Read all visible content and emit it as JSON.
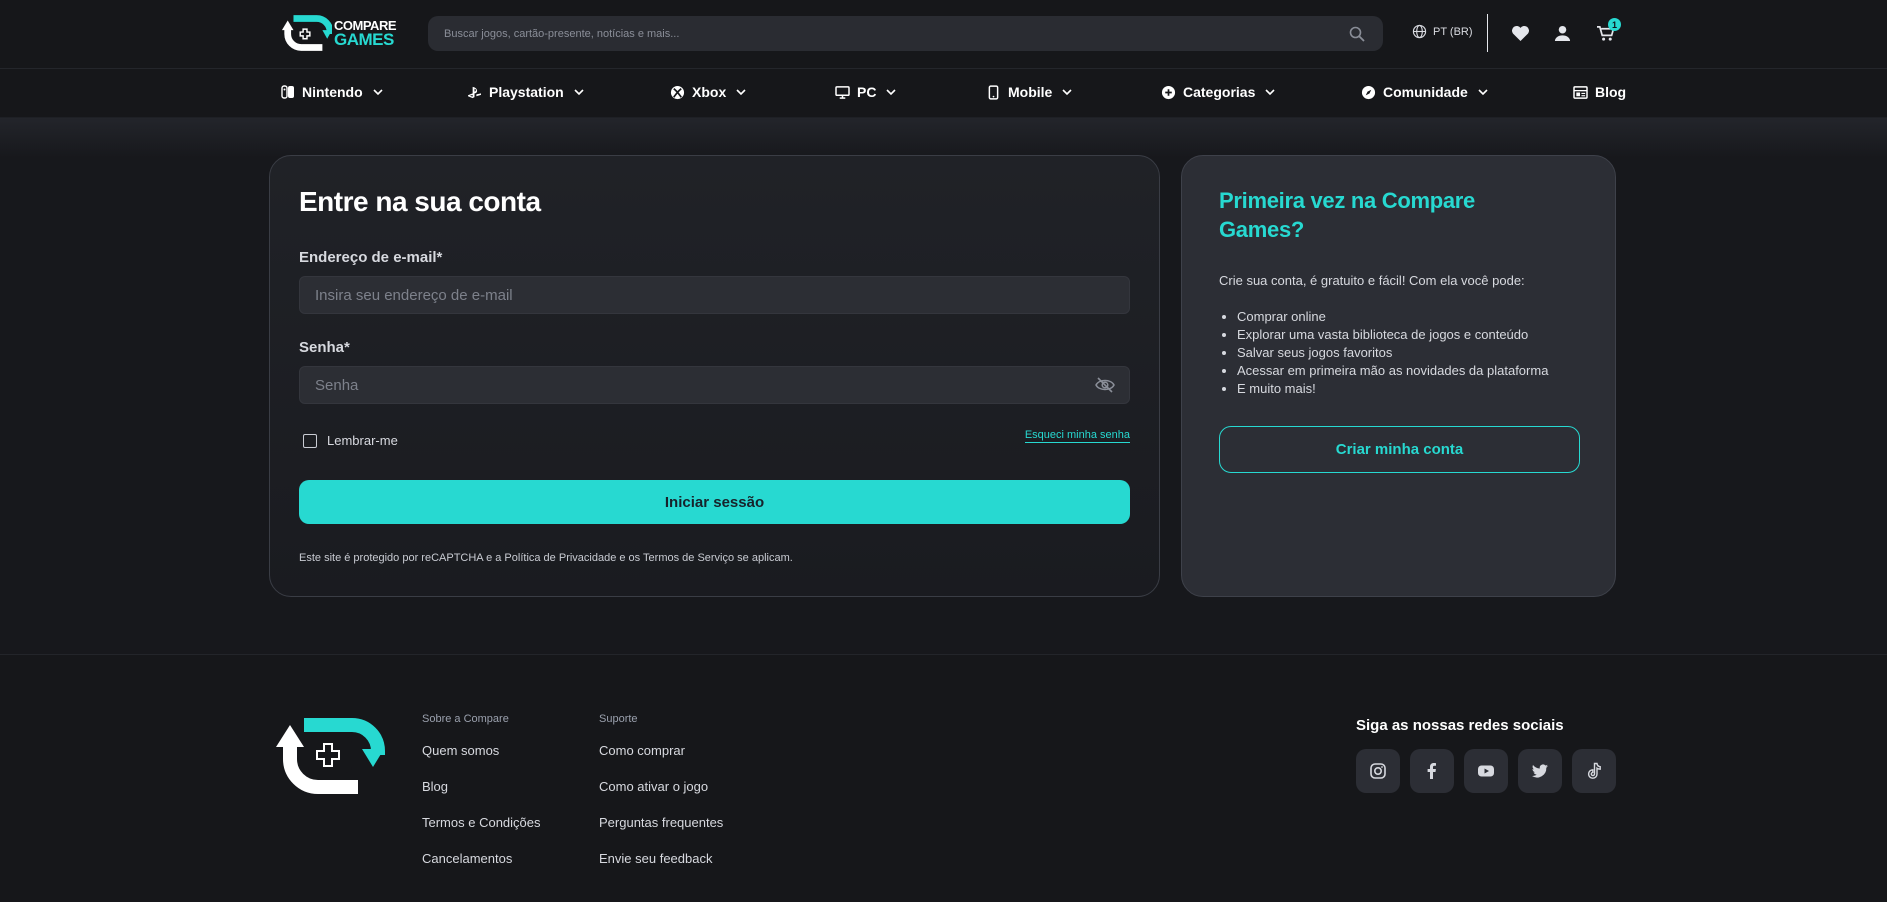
{
  "header": {
    "logo_line1": "COMPARE",
    "logo_line2": "GAMES",
    "search_placeholder": "Buscar jogos, cartão-presente, notícias e mais...",
    "language": "PT (BR)",
    "cart_count": "1"
  },
  "nav": {
    "items": [
      {
        "label": "Nintendo",
        "icon": "switch-icon"
      },
      {
        "label": "Playstation",
        "icon": "playstation-icon"
      },
      {
        "label": "Xbox",
        "icon": "xbox-icon"
      },
      {
        "label": "PC",
        "icon": "monitor-icon"
      },
      {
        "label": "Mobile",
        "icon": "phone-icon"
      },
      {
        "label": "Categorias",
        "icon": "plus-circle-icon"
      },
      {
        "label": "Comunidade",
        "icon": "compass-icon"
      },
      {
        "label": "Blog",
        "icon": "newspaper-icon"
      }
    ]
  },
  "login": {
    "title": "Entre na sua conta",
    "email_label": "Endereço de e-mail*",
    "email_placeholder": "Insira seu endereço de e-mail",
    "password_label": "Senha*",
    "password_placeholder": "Senha",
    "remember_label": "Lembrar-me",
    "forgot_label": "Esqueci minha senha",
    "submit_label": "Iniciar sessão",
    "recaptcha_text": "Este site é protegido por reCAPTCHA e a Política de Privacidade e os Termos de Serviço se aplicam."
  },
  "register": {
    "title": "Primeira vez na Compare Games?",
    "description": "Crie sua conta, é gratuito e fácil! Com ela você pode:",
    "benefits": [
      "Comprar online",
      "Explorar uma vasta biblioteca de jogos e conteúdo",
      "Salvar seus jogos favoritos",
      "Acessar em primeira mão as novidades da plataforma",
      "E muito mais!"
    ],
    "button_label": "Criar minha conta"
  },
  "footer": {
    "col1_title": "Sobre a Compare",
    "col1_links": [
      "Quem somos",
      "Blog",
      "Termos e Condições",
      "Cancelamentos"
    ],
    "col2_title": "Suporte",
    "col2_links": [
      "Como comprar",
      "Como ativar o jogo",
      "Perguntas frequentes",
      "Envie seu feedback"
    ],
    "social_title": "Siga as nossas redes sociais",
    "socials": [
      "instagram-icon",
      "facebook-icon",
      "youtube-icon",
      "twitter-icon",
      "tiktok-icon"
    ]
  },
  "colors": {
    "accent": "#27d9d1",
    "background": "#17181c",
    "card": "#2c2e35"
  }
}
